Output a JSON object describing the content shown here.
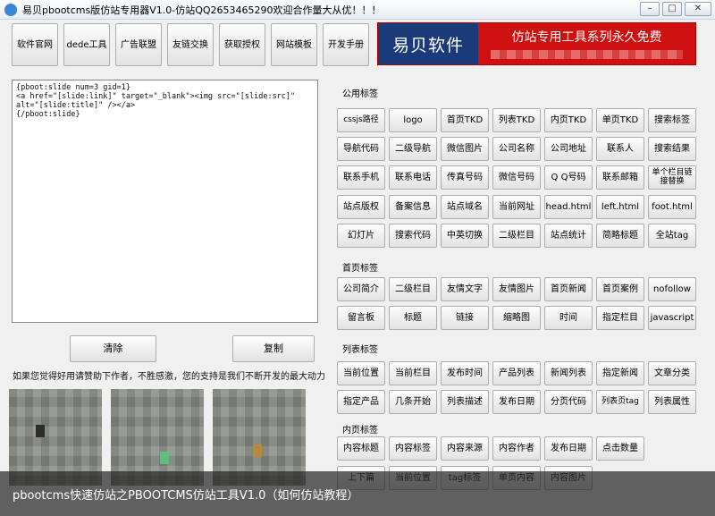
{
  "window": {
    "title": "易贝pbootcms版仿站专用器V1.0-仿站QQ2653465290欢迎合作量大从优！！！",
    "controls": [
      "–",
      "□",
      "✕"
    ]
  },
  "toolbar": [
    "软件官网",
    "dede工具",
    "广告联盟",
    "友链交换",
    "获取授权",
    "网站模板",
    "开发手册"
  ],
  "banner": {
    "brand": "易贝软件",
    "slogan": "仿站专用工具系列永久免费"
  },
  "editor": {
    "content": "{pboot:slide num=3 gid=1}\n<a href=\"[slide:link]\" target=\"_blank\"><img src=\"[slide:src]\"\nalt=\"[slide:title]\" /></a>\n{/pboot:slide}"
  },
  "actions": {
    "clear": "清除",
    "copy": "复制"
  },
  "support_text": "如果您觉得好用请赞助下作者，不胜感激，您的支持是我们不断开发的最大动力",
  "sections": {
    "common": {
      "label": "公用标签",
      "rows": [
        [
          "cssjs路径",
          "logo",
          "首页TKD",
          "列表TKD",
          "内页TKD",
          "单页TKD",
          "搜索标签"
        ],
        [
          "导航代码",
          "二级导航",
          "微信图片",
          "公司名称",
          "公司地址",
          "联系人",
          "搜索结果"
        ],
        [
          "联系手机",
          "联系电话",
          "传真号码",
          "微信号码",
          "Q Q号码",
          "联系邮箱",
          "单个栏目链接替换"
        ],
        [
          "站点版权",
          "备案信息",
          "站点域名",
          "当前网址",
          "head.html",
          "left.html",
          "foot.html"
        ],
        [
          "幻灯片",
          "搜索代码",
          "中英切换",
          "二级栏目",
          "站点统计",
          "简略标题",
          "全站tag"
        ]
      ]
    },
    "home": {
      "label": "首页标签",
      "rows": [
        [
          "公司简介",
          "二级栏目",
          "友情文字",
          "友情图片",
          "首页新闻",
          "首页案例",
          "nofollow"
        ],
        [
          "留言板",
          "标题",
          "链接",
          "缩略图",
          "时间",
          "指定栏目",
          "javascript"
        ]
      ]
    },
    "list": {
      "label": "列表标签",
      "rows": [
        [
          "当前位置",
          "当前栏目",
          "发布时间",
          "产品列表",
          "新闻列表",
          "指定新闻",
          "文章分类"
        ],
        [
          "指定产品",
          "几条开始",
          "列表描述",
          "发布日期",
          "分页代码",
          "列表页tag",
          "列表属性"
        ]
      ]
    },
    "detail": {
      "label": "内页标签",
      "rows": [
        [
          "内容标题",
          "内容标签",
          "内容来源",
          "内容作者",
          "发布日期",
          "点击数量"
        ],
        [
          "上下篇",
          "当前位置",
          "tag标签",
          "单页内容",
          "内容图片"
        ]
      ]
    }
  },
  "caption": "pbootcms快速仿站之PBOOTCMS仿站工具V1.0（如何仿站教程）",
  "colors": {
    "banner_blue": "#1b3a7a",
    "banner_red": "#cf1010"
  }
}
